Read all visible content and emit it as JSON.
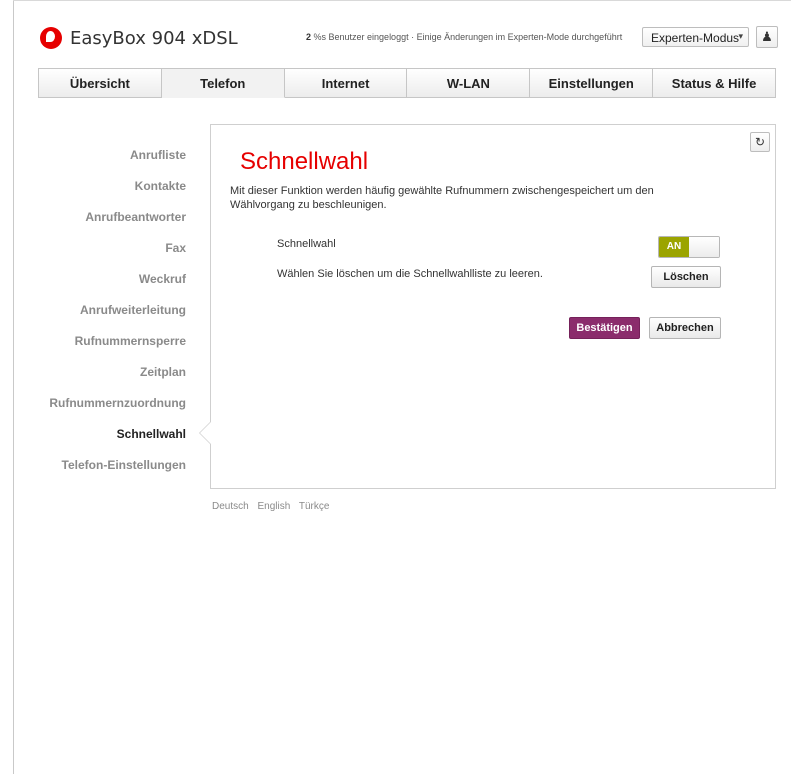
{
  "header": {
    "brand": "EasyBox 904 xDSL",
    "status_count": "2",
    "status_text": " %s Benutzer eingeloggt · Einige Änderungen im Experten-Mode durchgeführt",
    "mode_selected": "Experten-Modus",
    "user_icon": "user-icon",
    "brand_color": "#e60000"
  },
  "tabs": [
    {
      "label": "Übersicht"
    },
    {
      "label": "Telefon"
    },
    {
      "label": "Internet"
    },
    {
      "label": "W-LAN"
    },
    {
      "label": "Einstellungen"
    },
    {
      "label": "Status & Hilfe"
    }
  ],
  "active_tab": "Telefon",
  "sidebar": {
    "items": [
      {
        "label": "Anrufliste"
      },
      {
        "label": "Kontakte"
      },
      {
        "label": "Anrufbeantworter"
      },
      {
        "label": "Fax"
      },
      {
        "label": "Weckruf"
      },
      {
        "label": "Anrufweiterleitung"
      },
      {
        "label": "Rufnummernsperre"
      },
      {
        "label": "Zeitplan"
      },
      {
        "label": "Rufnummernzuordnung"
      },
      {
        "label": "Schnellwahl"
      },
      {
        "label": "Telefon-Einstellungen"
      }
    ],
    "active": "Schnellwahl"
  },
  "panel": {
    "title": "Schnellwahl",
    "description": "Mit dieser Funktion werden häufig gewählte Rufnummern zwischengespeichert um den Wählvorgang zu beschleunigen.",
    "toggle_row_label": "Schnellwahl",
    "toggle_state": "AN",
    "toggle_color": "#9ba400",
    "clear_row_label": "Wählen Sie löschen um die Schnellwahlliste zu leeren.",
    "clear_button": "Löschen",
    "confirm_button": "Bestätigen",
    "confirm_color": "#8b2c6c",
    "cancel_button": "Abbrechen",
    "refresh_icon": "refresh-icon"
  },
  "languages": [
    "Deutsch",
    "English",
    "Türkçe"
  ]
}
